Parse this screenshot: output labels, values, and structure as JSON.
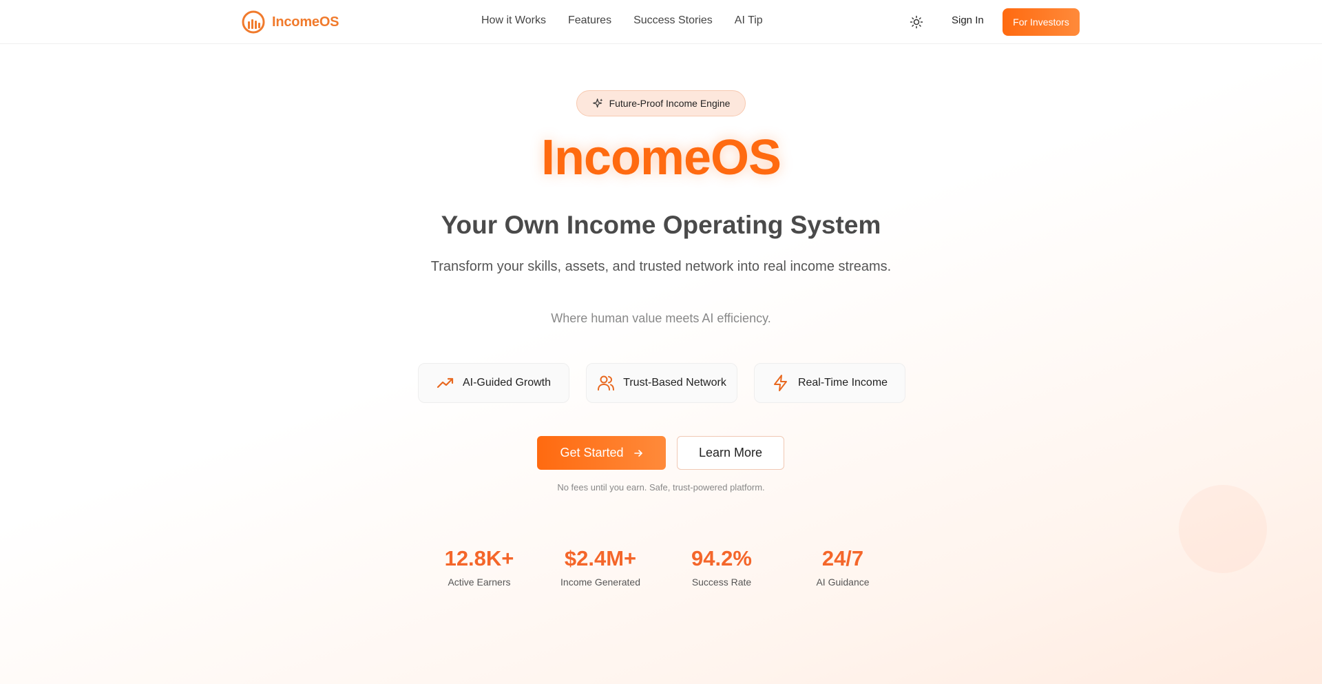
{
  "brand": {
    "name": "IncomeOS",
    "accent": "#ff6a10",
    "icon": "logo-bars-icon"
  },
  "nav": {
    "items": [
      "How it Works",
      "Features",
      "Success Stories",
      "AI Tip"
    ],
    "theme_icon": "sun-icon",
    "sign_in": "Sign In",
    "investors": "For Investors"
  },
  "hero": {
    "badge": {
      "icon": "sparkles-icon",
      "label": "Future-Proof Income Engine"
    },
    "title": "IncomeOS",
    "subtitle": "Your Own Income Operating System",
    "description": "Transform your skills, assets, and trusted network into real income streams.",
    "tagline": "Where human value meets AI efficiency.",
    "features": [
      {
        "icon": "trending-up-icon",
        "label": "AI-Guided Growth"
      },
      {
        "icon": "users-icon",
        "label": "Trust-Based Network"
      },
      {
        "icon": "lightning-icon",
        "label": "Real-Time Income"
      }
    ],
    "cta_primary": "Get Started",
    "cta_primary_icon": "arrow-right-icon",
    "cta_secondary": "Learn More",
    "fine_print": "No fees until you earn. Safe, trust-powered platform."
  },
  "stats": [
    {
      "value": "12.8K+",
      "label": "Active Earners"
    },
    {
      "value": "$2.4M+",
      "label": "Income Generated"
    },
    {
      "value": "94.2%",
      "label": "Success Rate"
    },
    {
      "value": "24/7",
      "label": "AI Guidance"
    }
  ]
}
